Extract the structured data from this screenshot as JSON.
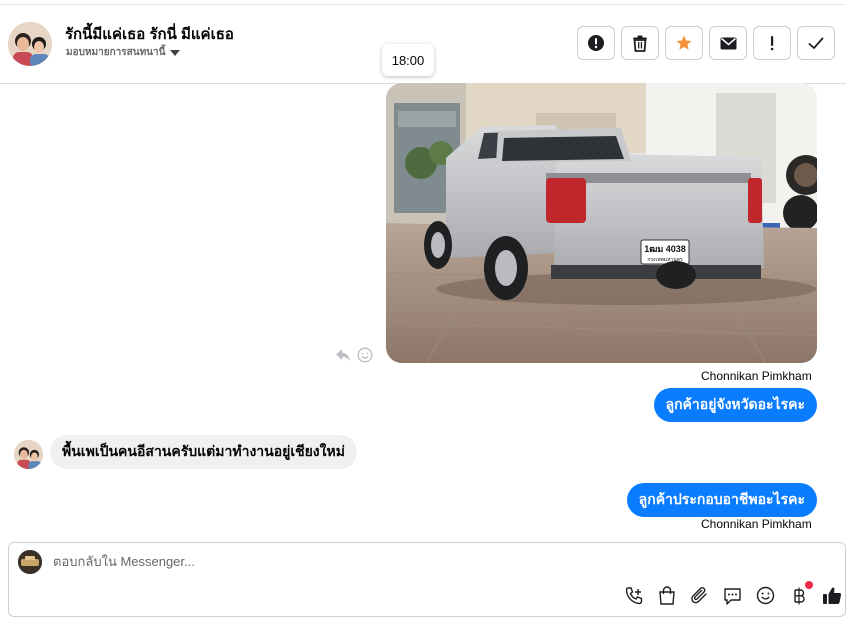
{
  "header": {
    "contact_name": "รักนี้มีแค่เธอ รักนี่ มีแค่เธอ",
    "assign_label": "มอบหมายการสนทนานี้"
  },
  "actions": [
    {
      "name": "mark-spam",
      "icon": "alert-circle-icon"
    },
    {
      "name": "delete",
      "icon": "trash-icon"
    },
    {
      "name": "star",
      "icon": "star-icon"
    },
    {
      "name": "mark-unread",
      "icon": "envelope-icon"
    },
    {
      "name": "follow-up",
      "icon": "exclamation-icon"
    },
    {
      "name": "mark-done",
      "icon": "check-icon"
    }
  ],
  "tooltip": {
    "time": "18:00"
  },
  "messages": {
    "sender_1": "Chonnikan Pimkham",
    "out_1": "ลูกค้าอยู่จังหวัดอะไรคะ",
    "in_1": "พื้นเพเป็นคนอีสานครับแต่มาทำงานอยู่เชียงใหม่",
    "out_2": "ลูกค้าประกอบอาชีพอะไรคะ",
    "sender_2": "Chonnikan Pimkham"
  },
  "photo": {
    "plate_line1": "1ฒม 4038",
    "plate_line2": "กรุงเทพมหานคร"
  },
  "composer": {
    "placeholder": "ตอบกลับใน Messenger...",
    "tools": [
      "phone-plus-icon",
      "shopping-bag-icon",
      "paperclip-icon",
      "chat-bubble-icon",
      "emoji-icon",
      "baht-icon",
      "thumbs-up-icon"
    ]
  },
  "colors": {
    "accent": "#0a7cff",
    "star": "#f7923a",
    "badge": "#f02849"
  }
}
